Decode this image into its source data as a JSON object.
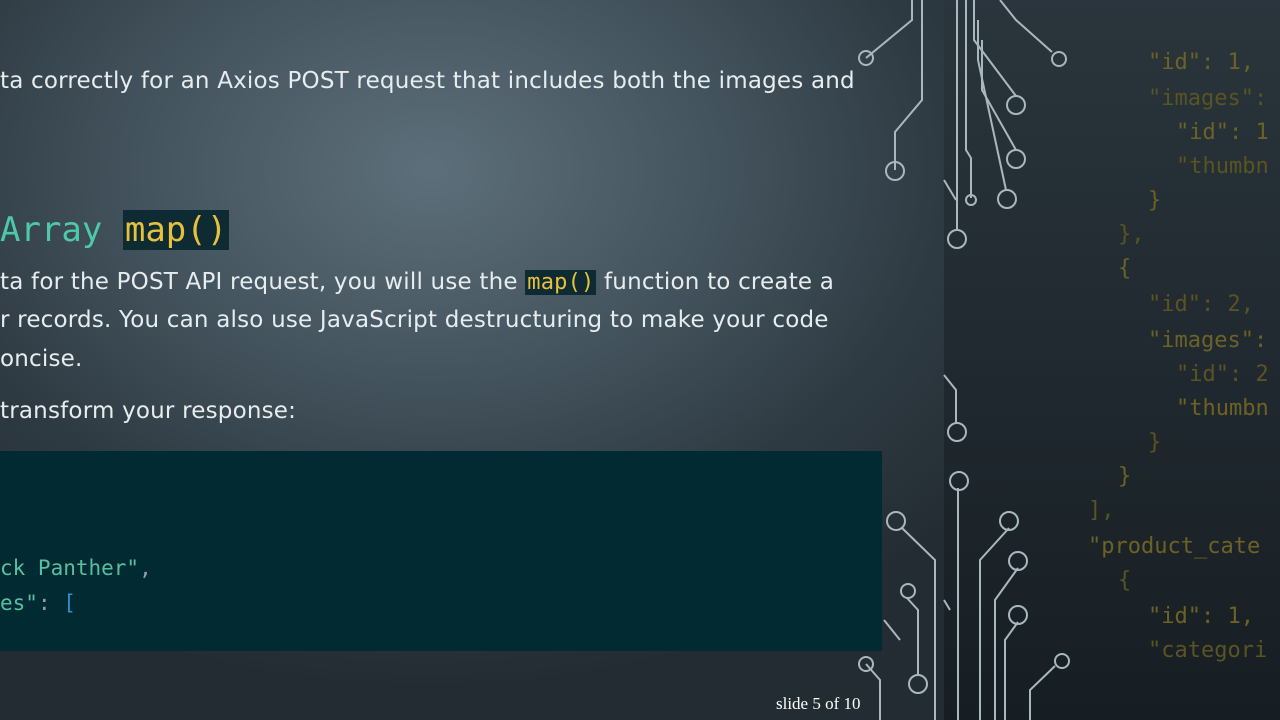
{
  "body": {
    "intro_line": "ta correctly for an Axios POST request that includes both the images and",
    "heading_prefix": "Array",
    "heading_code": "map()",
    "para_line1_before": "ta for the POST API request, you will use the",
    "para_line1_code": "map()",
    "para_line1_after": "function to create a",
    "para_line2": "r records. You can also use JavaScript destructuring to make your code",
    "para_line3": "oncise.",
    "transform_line": "transform your response:"
  },
  "code_block": {
    "line1_str": "ck Panther\"",
    "line1_punc": ",",
    "line2_str": "es\"",
    "line2_punc": ":",
    "line2_bracket": "["
  },
  "right_code": {
    "lines": [
      "\"id\": 1,",
      "\"images\":",
      "  \"id\": 1",
      "  \"thumbn",
      "}",
      "},",
      "{",
      "  \"id\": 2,",
      "  \"images\":",
      "    \"id\": 2",
      "    \"thumbn",
      "  }",
      "}",
      "],",
      "\"product_cate",
      "  {",
      "    \"id\": 1,",
      "    \"categori"
    ]
  },
  "footer": {
    "slide_indicator": "slide 5 of 10"
  },
  "colors": {
    "teal_heading": "#4ec9a8",
    "code_yellow": "#e6c13d",
    "code_block_bg": "#022a33",
    "right_code_text": "#6d6226"
  }
}
